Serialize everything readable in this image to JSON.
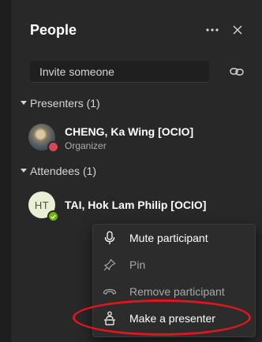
{
  "header": {
    "title": "People"
  },
  "invite": {
    "placeholder": "Invite someone"
  },
  "presenters": {
    "label": "Presenters (1)",
    "people": [
      {
        "name": "CHENG, Ka Wing [OCIO]",
        "role": "Organizer",
        "status": "busy"
      }
    ]
  },
  "attendees": {
    "label": "Attendees (1)",
    "people": [
      {
        "name": "TAI, Hok Lam Philip [OCIO]",
        "initials": "HT",
        "status": "available"
      }
    ]
  },
  "context_menu": {
    "items": [
      {
        "label": "Mute participant",
        "icon": "microphone-icon",
        "enabled": true
      },
      {
        "label": "Pin",
        "icon": "pin-icon",
        "enabled": false
      },
      {
        "label": "Remove participant",
        "icon": "hang-up-icon",
        "enabled": false
      },
      {
        "label": "Make a presenter",
        "icon": "presenter-icon",
        "enabled": true
      }
    ]
  },
  "colors": {
    "background": "#292828",
    "busy": "#d74553",
    "available": "#6bb700",
    "annotation": "#e0161e"
  }
}
